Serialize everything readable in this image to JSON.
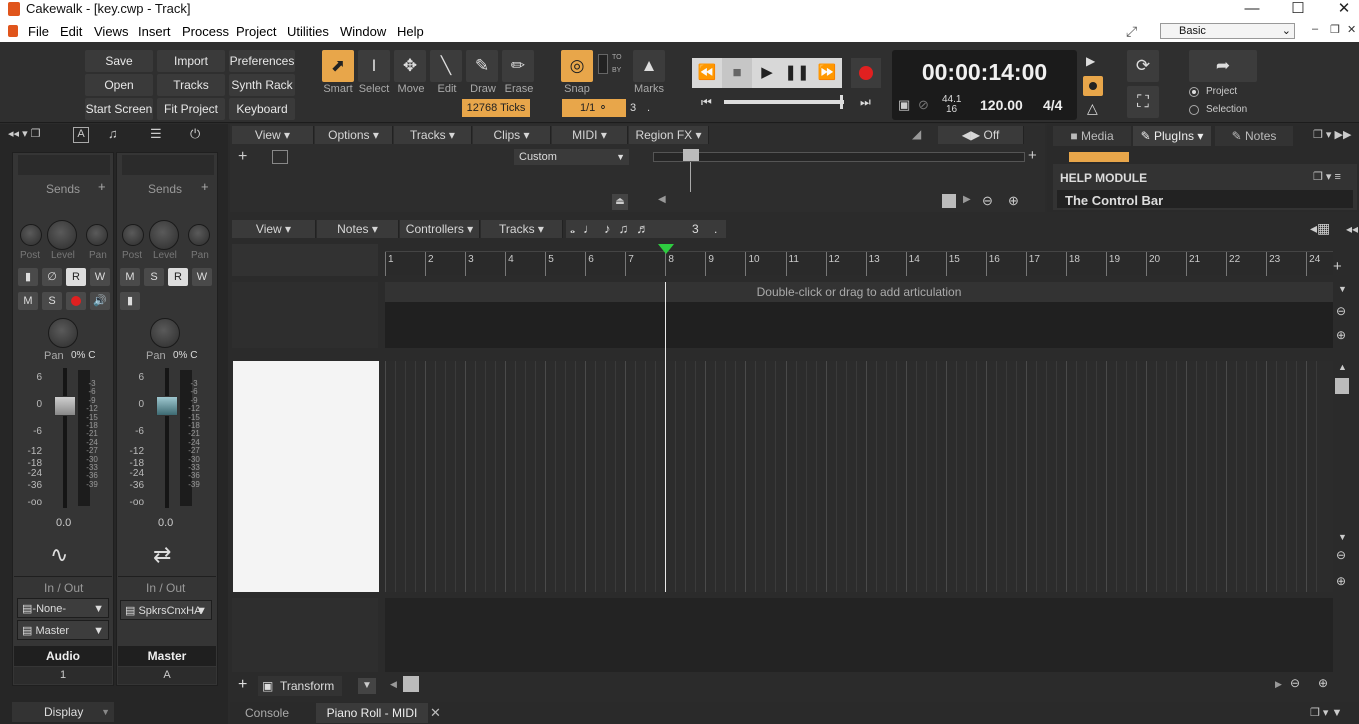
{
  "window": {
    "title": "Cakewalk - [key.cwp - Track]"
  },
  "menu": [
    "File",
    "Edit",
    "Views",
    "Insert",
    "Process",
    "Project",
    "Utilities",
    "Window",
    "Help"
  ],
  "workspace": {
    "selected": "Basic"
  },
  "control_bar": {
    "buttons": [
      [
        "Save",
        "Import",
        "Preferences"
      ],
      [
        "Open",
        "Tracks",
        "Synth Rack"
      ],
      [
        "Start Screen",
        "Fit Project",
        "Keyboard"
      ]
    ],
    "tools": [
      "Smart",
      "Select",
      "Move",
      "Edit",
      "Draw",
      "Erase"
    ],
    "snap_label": "Snap",
    "snap_value": "1/1",
    "snap_ticks": "12768 Ticks",
    "snap_to_by": [
      "TO",
      "BY"
    ],
    "marks_label": "Marks",
    "tuplet": "3",
    "dot": ".",
    "time": "00:00:14:00",
    "sample_rate": "44.1",
    "bit_depth": "16",
    "tempo": "120.00",
    "meter": "4/4",
    "mode_project": "Project",
    "mode_selection": "Selection"
  },
  "inspector": {
    "strips": [
      {
        "sends": "Sends",
        "post": "Post",
        "level": "Level",
        "pan": "Pan",
        "pan_value": "0% C",
        "volume": "0.0",
        "io": "In / Out",
        "input": "-None-",
        "output": "Master",
        "name": "Audio",
        "number": "1"
      },
      {
        "sends": "Sends",
        "post": "Post",
        "level": "Level",
        "pan": "Pan",
        "pan_value": "0% C",
        "volume": "0.0",
        "io": "In / Out",
        "input": "SpkrsCnxHA",
        "output": "",
        "name": "Master",
        "number": "A"
      }
    ],
    "scale_left": [
      "6",
      "0",
      "-6",
      "-12",
      "-18",
      "-24",
      "-36",
      "-oo"
    ],
    "scale_meter": [
      "-3",
      "-6",
      "-9",
      "-12",
      "-15",
      "-18",
      "-21",
      "-24",
      "-27",
      "-30",
      "-33",
      "-36",
      "-39"
    ],
    "display": "Display"
  },
  "track_view": {
    "menus": [
      "View",
      "Options",
      "Tracks",
      "Clips",
      "MIDI",
      "Region FX"
    ],
    "off_label": "Off",
    "custom": "Custom"
  },
  "browser": {
    "tabs": [
      "Media",
      "PlugIns",
      "Notes"
    ],
    "help_title": "HELP MODULE",
    "help_text": "The Control Bar"
  },
  "piano_roll": {
    "menus": [
      "View",
      "Notes",
      "Controllers",
      "Tracks"
    ],
    "tuplet": "3",
    "dot": ".",
    "ruler": [
      "1",
      "2",
      "3",
      "4",
      "5",
      "6",
      "7",
      "8",
      "9",
      "10",
      "11",
      "12",
      "13",
      "14",
      "15",
      "16",
      "17",
      "18",
      "19",
      "20",
      "21",
      "22",
      "23",
      "24"
    ],
    "articulation_hint": "Double-click or drag to add articulation",
    "transform": "Transform"
  },
  "bottom_tabs": [
    "Console",
    "Piano Roll - MIDI"
  ],
  "colors": {
    "accent": "#e8a64a",
    "playhead": "#2ecc40",
    "record": "#e02020"
  }
}
